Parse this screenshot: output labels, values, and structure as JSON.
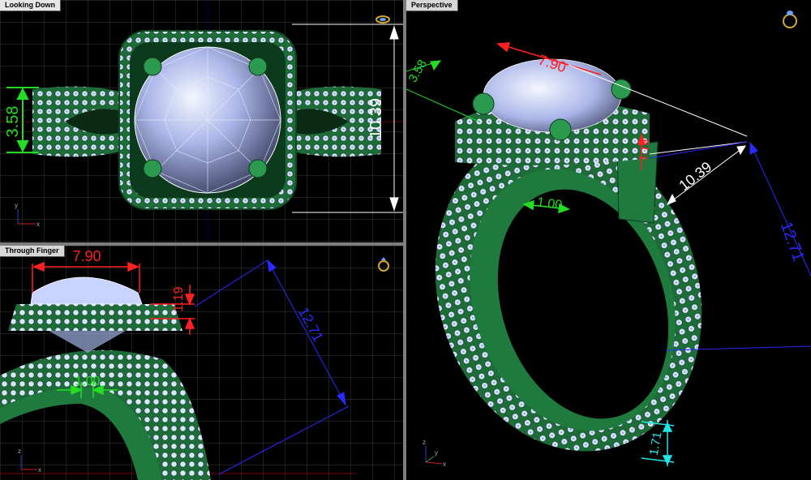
{
  "viewports": {
    "top": {
      "label": "Looking Down"
    },
    "front": {
      "label": "Through Finger"
    },
    "perspective": {
      "label": "Perspective"
    }
  },
  "dimensions": {
    "top_width": "3.58",
    "top_length": "10.39",
    "front_diameter": "7.90",
    "front_height": "1.19",
    "front_diagonal": "12.71",
    "front_band": "1.00",
    "persp_diameter": "7.90",
    "persp_width": "3.58",
    "persp_height": "1.19",
    "persp_length": "10.39",
    "persp_band": "1.00",
    "persp_diagonal": "12.71",
    "persp_shank": "1.71"
  },
  "axes": {
    "x": "x",
    "y": "y",
    "z": "z"
  },
  "colors": {
    "metal": "#1f7a3e",
    "metal_light": "#3aa35c",
    "gem": "#c8d4ff",
    "grid": "#3a3a3a",
    "dim_green": "#22dd22",
    "dim_red": "#ff2020",
    "dim_white": "#ffffff",
    "dim_blue": "#2a2aff",
    "dim_cyan": "#22e6e6"
  },
  "icons": [
    "ring-view-icon"
  ]
}
